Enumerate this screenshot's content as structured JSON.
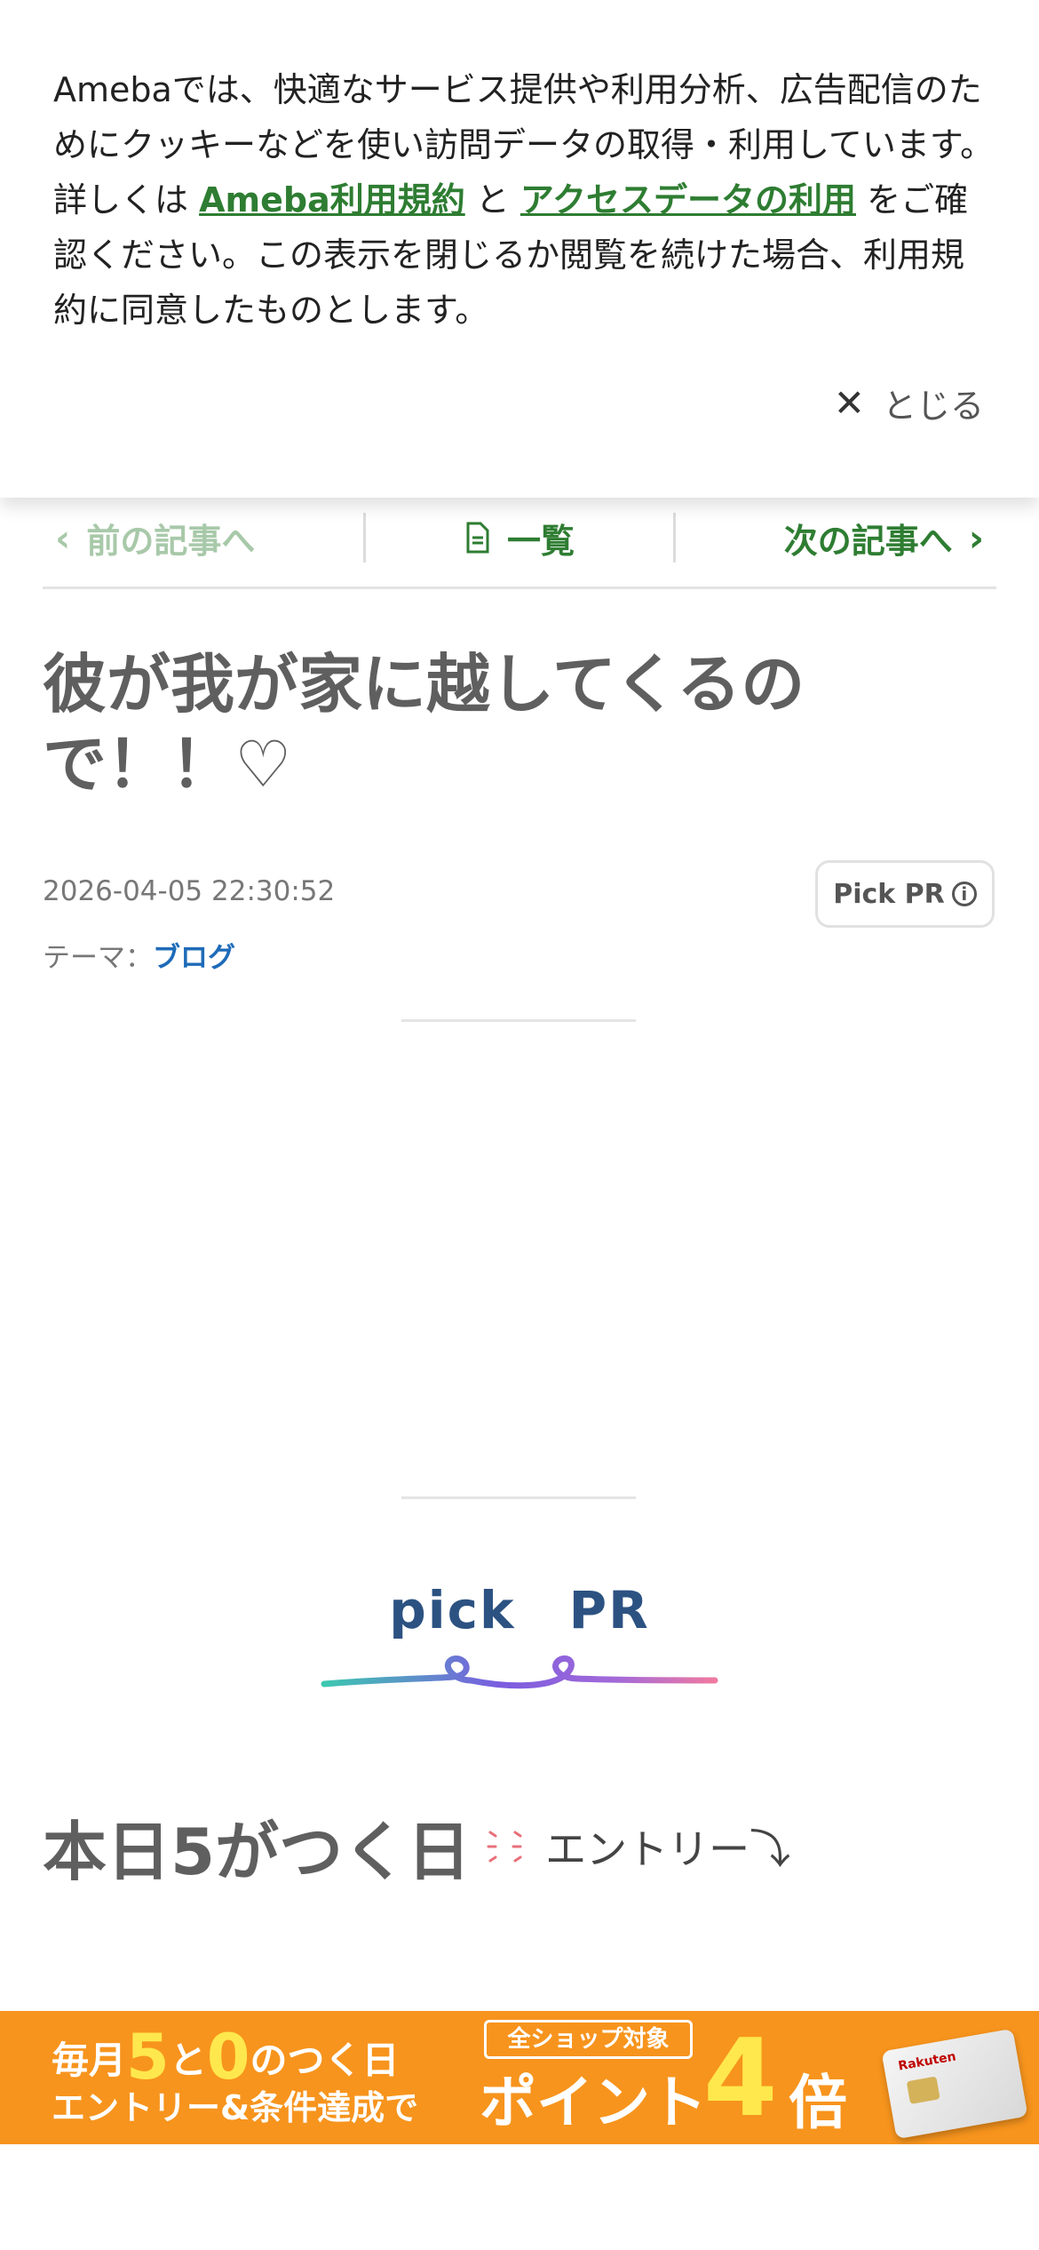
{
  "cookie_banner": {
    "text_before": "Amebaでは、快適なサービス提供や利用分析、広告配信のためにクッキーなどを使い訪問データの取得・利用しています。詳しくは ",
    "link_terms": "Ameba利用規約",
    "text_and": " と ",
    "link_access": "アクセスデータの利用",
    "text_after": " をご確認ください。この表示を閉じるか閲覧を続けた場合、利用規約に同意したものとします。",
    "close_label": "とじる",
    "close_icon": "close-icon"
  },
  "article_nav": {
    "prev_label": "前の記事へ",
    "list_label": "一覧",
    "next_label": "次の記事へ",
    "list_icon": "document-icon"
  },
  "article": {
    "title": "彼が我が家に越してくるので！！♡",
    "timestamp": "2026-04-05 22:30:52",
    "pick_label": "Pick PR",
    "theme_prefix": "テーマ：",
    "theme": "ブログ"
  },
  "pickpr": {
    "title": "pick　PR"
  },
  "entry": {
    "heading": "本日5がつく日",
    "sub": "エントリー⤵"
  },
  "promo": {
    "line1_a": "毎月",
    "line1_5": "5",
    "line1_to": "と",
    "line1_0": "0",
    "line1_b": "のつく日",
    "line2": "エントリー&条件達成で",
    "tag": "全ショップ対象",
    "point": "ポイント",
    "mult": "4",
    "bai": "倍",
    "card_logo": "Rakuten"
  },
  "colors": {
    "accent_green": "#2e7d32",
    "link_blue": "#1e6bb8",
    "pickpr_navy": "#2c5282",
    "promo_orange": "#f7941d"
  }
}
